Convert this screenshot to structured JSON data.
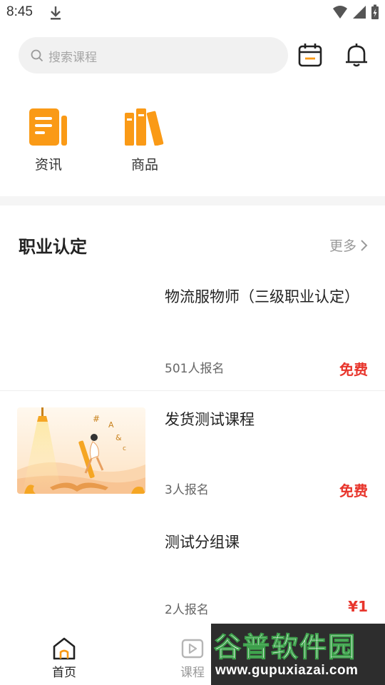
{
  "status_bar": {
    "time": "8:45"
  },
  "search": {
    "placeholder": "搜索课程"
  },
  "quick_entries": [
    {
      "label": "资讯",
      "icon": "document-icon"
    },
    {
      "label": "商品",
      "icon": "books-icon"
    }
  ],
  "section": {
    "title": "职业认定",
    "more_label": "更多"
  },
  "courses": [
    {
      "title": "物流服物师（三级职业认定）",
      "enrolled": "501人报名",
      "price": "免费"
    },
    {
      "title": "发货测试课程",
      "enrolled": "3人报名",
      "price": "免费"
    },
    {
      "title": "测试分组课",
      "enrolled": "2人报名",
      "price": "¥1"
    }
  ],
  "bottom_nav": [
    {
      "label": "首页",
      "active": true
    },
    {
      "label": "课程",
      "active": false
    }
  ],
  "watermark": {
    "title": "谷普软件园",
    "url": "www.gupuxiazai.com"
  },
  "colors": {
    "accent_orange": "#fa9a16",
    "price_red": "#e8352c",
    "divider": "#f5f5f5"
  }
}
